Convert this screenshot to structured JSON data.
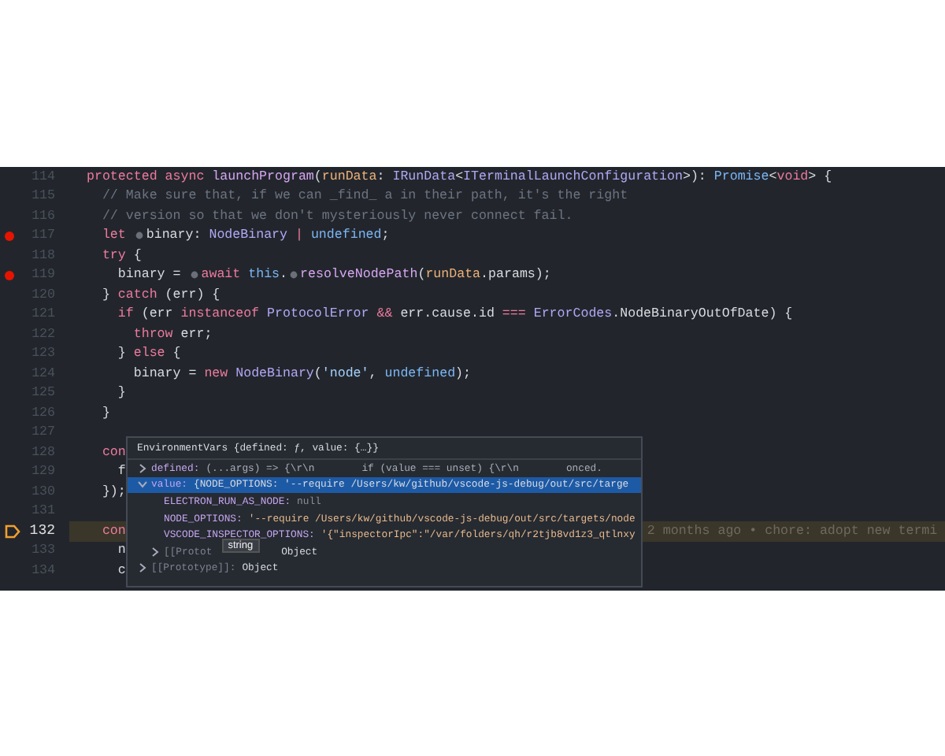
{
  "editor": {
    "lines": [
      {
        "number": "114",
        "breakpoint": false,
        "current": false,
        "tokens": [
          {
            "kind": "kw",
            "text": "protected async "
          },
          {
            "kind": "fn",
            "text": "launchProgram"
          },
          {
            "kind": "plain",
            "text": "("
          },
          {
            "kind": "param",
            "text": "runData"
          },
          {
            "kind": "plain",
            "text": ": "
          },
          {
            "kind": "type",
            "text": "IRunData"
          },
          {
            "kind": "plain",
            "text": "<"
          },
          {
            "kind": "type",
            "text": "ITerminalLaunchConfiguration"
          },
          {
            "kind": "plain",
            "text": ">): "
          },
          {
            "kind": "builtin",
            "text": "Promise"
          },
          {
            "kind": "plain",
            "text": "<"
          },
          {
            "kind": "kw",
            "text": "void"
          },
          {
            "kind": "plain",
            "text": "> {"
          }
        ]
      },
      {
        "number": "115",
        "breakpoint": false,
        "current": false,
        "tokens": [
          {
            "kind": "com",
            "text": "  // Make sure that, if we can _find_ a in their path, it's the right"
          }
        ]
      },
      {
        "number": "116",
        "breakpoint": false,
        "current": false,
        "tokens": [
          {
            "kind": "com",
            "text": "  // version so that we don't mysteriously never connect fail."
          }
        ]
      },
      {
        "number": "117",
        "breakpoint": true,
        "current": false,
        "tokens": [
          {
            "kind": "kw",
            "text": "  let "
          },
          {
            "kind": "dot"
          },
          {
            "kind": "plain",
            "text": "binary: "
          },
          {
            "kind": "type",
            "text": "NodeBinary"
          },
          {
            "kind": "op",
            "text": " | "
          },
          {
            "kind": "builtin",
            "text": "undefined"
          },
          {
            "kind": "plain",
            "text": ";"
          }
        ]
      },
      {
        "number": "118",
        "breakpoint": false,
        "current": false,
        "tokens": [
          {
            "kind": "kw",
            "text": "  try"
          },
          {
            "kind": "plain",
            "text": " {"
          }
        ]
      },
      {
        "number": "119",
        "breakpoint": true,
        "current": false,
        "tokens": [
          {
            "kind": "plain",
            "text": "    binary = "
          },
          {
            "kind": "dot"
          },
          {
            "kind": "kw",
            "text": "await "
          },
          {
            "kind": "builtin",
            "text": "this"
          },
          {
            "kind": "plain",
            "text": "."
          },
          {
            "kind": "dot"
          },
          {
            "kind": "fn",
            "text": "resolveNodePath"
          },
          {
            "kind": "plain",
            "text": "("
          },
          {
            "kind": "param",
            "text": "runData"
          },
          {
            "kind": "plain",
            "text": ".params);"
          }
        ]
      },
      {
        "number": "120",
        "breakpoint": false,
        "current": false,
        "tokens": [
          {
            "kind": "plain",
            "text": "  } "
          },
          {
            "kind": "kw",
            "text": "catch"
          },
          {
            "kind": "plain",
            "text": " (err) {"
          }
        ]
      },
      {
        "number": "121",
        "breakpoint": false,
        "current": false,
        "tokens": [
          {
            "kind": "kw",
            "text": "    if"
          },
          {
            "kind": "plain",
            "text": " (err "
          },
          {
            "kind": "kw",
            "text": "instanceof "
          },
          {
            "kind": "type",
            "text": "ProtocolError"
          },
          {
            "kind": "op",
            "text": " && "
          },
          {
            "kind": "plain",
            "text": "err.cause.id "
          },
          {
            "kind": "op",
            "text": "=== "
          },
          {
            "kind": "type",
            "text": "ErrorCodes"
          },
          {
            "kind": "plain",
            "text": ".NodeBinaryOutOfDate) {"
          }
        ]
      },
      {
        "number": "122",
        "breakpoint": false,
        "current": false,
        "tokens": [
          {
            "kind": "kw",
            "text": "      throw"
          },
          {
            "kind": "plain",
            "text": " err;"
          }
        ]
      },
      {
        "number": "123",
        "breakpoint": false,
        "current": false,
        "tokens": [
          {
            "kind": "plain",
            "text": "    } "
          },
          {
            "kind": "kw",
            "text": "else"
          },
          {
            "kind": "plain",
            "text": " {"
          }
        ]
      },
      {
        "number": "124",
        "breakpoint": false,
        "current": false,
        "tokens": [
          {
            "kind": "plain",
            "text": "      binary = "
          },
          {
            "kind": "kw",
            "text": "new "
          },
          {
            "kind": "type",
            "text": "NodeBinary"
          },
          {
            "kind": "plain",
            "text": "("
          },
          {
            "kind": "str",
            "text": "'node'"
          },
          {
            "kind": "plain",
            "text": ", "
          },
          {
            "kind": "builtin",
            "text": "undefined"
          },
          {
            "kind": "plain",
            "text": ");"
          }
        ]
      },
      {
        "number": "125",
        "breakpoint": false,
        "current": false,
        "tokens": [
          {
            "kind": "plain",
            "text": "    }"
          }
        ]
      },
      {
        "number": "126",
        "breakpoint": false,
        "current": false,
        "tokens": [
          {
            "kind": "plain",
            "text": "  }"
          }
        ]
      },
      {
        "number": "127",
        "breakpoint": false,
        "current": false
      },
      {
        "number": "128",
        "breakpoint": false,
        "current": false,
        "tokens": [
          {
            "kind": "kw",
            "text": "  con"
          }
        ]
      },
      {
        "number": "129",
        "breakpoint": false,
        "current": false,
        "tokens": [
          {
            "kind": "plain",
            "text": "    f"
          }
        ]
      },
      {
        "number": "130",
        "breakpoint": false,
        "current": false,
        "tokens": [
          {
            "kind": "plain",
            "text": "  });"
          }
        ]
      },
      {
        "number": "131",
        "breakpoint": false,
        "current": false
      },
      {
        "number": "132",
        "breakpoint": false,
        "current": true,
        "tokens": [
          {
            "kind": "kw",
            "text": "  con"
          },
          {
            "kind": "blame",
            "text": "2 months ago • chore: adopt new termi"
          }
        ]
      },
      {
        "number": "133",
        "breakpoint": false,
        "current": false,
        "tokens": [
          {
            "kind": "plain",
            "text": "    n"
          }
        ]
      },
      {
        "number": "134",
        "breakpoint": false,
        "current": false,
        "tokens": [
          {
            "kind": "plain",
            "text": "    c"
          }
        ]
      }
    ]
  },
  "hover": {
    "header": "EnvironmentVars {defined: ƒ, value: {…}}",
    "rows": [
      {
        "key": "defined:",
        "kind": "function",
        "parts": [
          "(...args) => {\\r\\n",
          "if (value === unset) {\\r\\n",
          "onced."
        ],
        "expanded": false,
        "selected": false
      },
      {
        "key": "value:",
        "kind": "object",
        "parts": [
          "{NODE_OPTIONS: '--require /Users/kw/github/vscode-js-debug/out/src/targe"
        ],
        "expanded": true,
        "selected": true,
        "children": [
          {
            "key": "ELECTRON_RUN_AS_NODE:",
            "kind": "null",
            "parts": [
              "null"
            ],
            "selected": false
          },
          {
            "key": "NODE_OPTIONS:",
            "kind": "string",
            "parts": [
              "'--require /Users/kw/github/vscode-js-debug/out/src/targets/node"
            ],
            "selected": false
          },
          {
            "key": "VSCODE_INSPECTOR_OPTIONS:",
            "kind": "string",
            "parts": [
              "'{\"inspectorIpc\":\"/var/folders/qh/r2tjb8vd1z3_qtlnxy"
            ],
            "selected": false
          },
          {
            "key": "[[Protot",
            "tooltip": "string",
            "kind": "proto",
            "parts": [
              "Object"
            ],
            "expanded": false,
            "selected": false
          }
        ]
      },
      {
        "key": "[[Prototype]]:",
        "kind": "proto",
        "parts": [
          "Object"
        ],
        "expanded": false,
        "selected": false
      }
    ]
  }
}
